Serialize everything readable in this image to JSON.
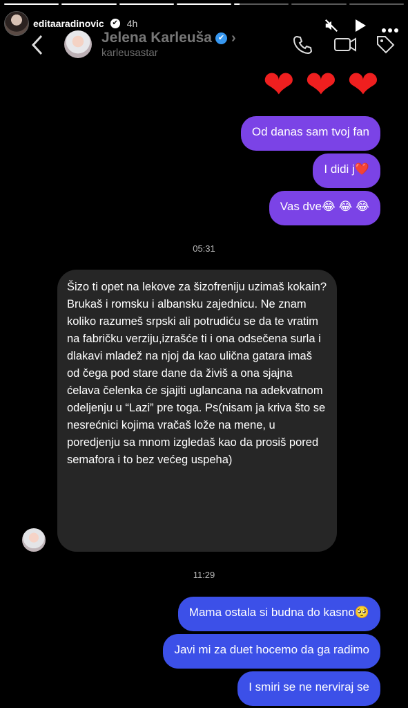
{
  "story": {
    "username": "editaaradinovic",
    "time": "4h"
  },
  "chat": {
    "name": "Jelena Karleuša",
    "handle": "karleusastar"
  },
  "messages": [
    {
      "type": "sent",
      "text": "Od danas sam tvoj fan"
    },
    {
      "type": "sent",
      "text": "I didi j❤️"
    },
    {
      "type": "sent",
      "text": "Vas dve😂 😂 😂"
    },
    {
      "type": "timestamp",
      "text": "05:31"
    },
    {
      "type": "received",
      "text": "Šizo ti opet na lekove za šizofreniju uzimaš kokain? Brukaš i romsku i albansku zajednicu. Ne znam koliko razumeš srpski ali potrudiću se da te vratim na fabričku verziju,izrašće ti i ona odsečena surla i dlakavi mladež na njoj da kao ulična gatara imaš od čega pod stare dane da živiš a ona sjajna ćelava čelenka će sjajiti uglancana na adekvatnom odeljenju u “Lazi” pre toga. Ps(nisam ja kriva što se nesrećnici kojima vračaš lože na mene, u poredjenju sa mnom izgledaš kao da prosiš pored semafora i to bez većeg uspeha)"
    },
    {
      "type": "timestamp",
      "text": "11:29"
    },
    {
      "type": "sent",
      "text": "Mama ostala si budna do kasno🥺"
    },
    {
      "type": "sent",
      "text": "Javi mi za duet hocemo da ga radimo"
    },
    {
      "type": "sent",
      "text": "I smiri se ne nerviraj se"
    }
  ]
}
